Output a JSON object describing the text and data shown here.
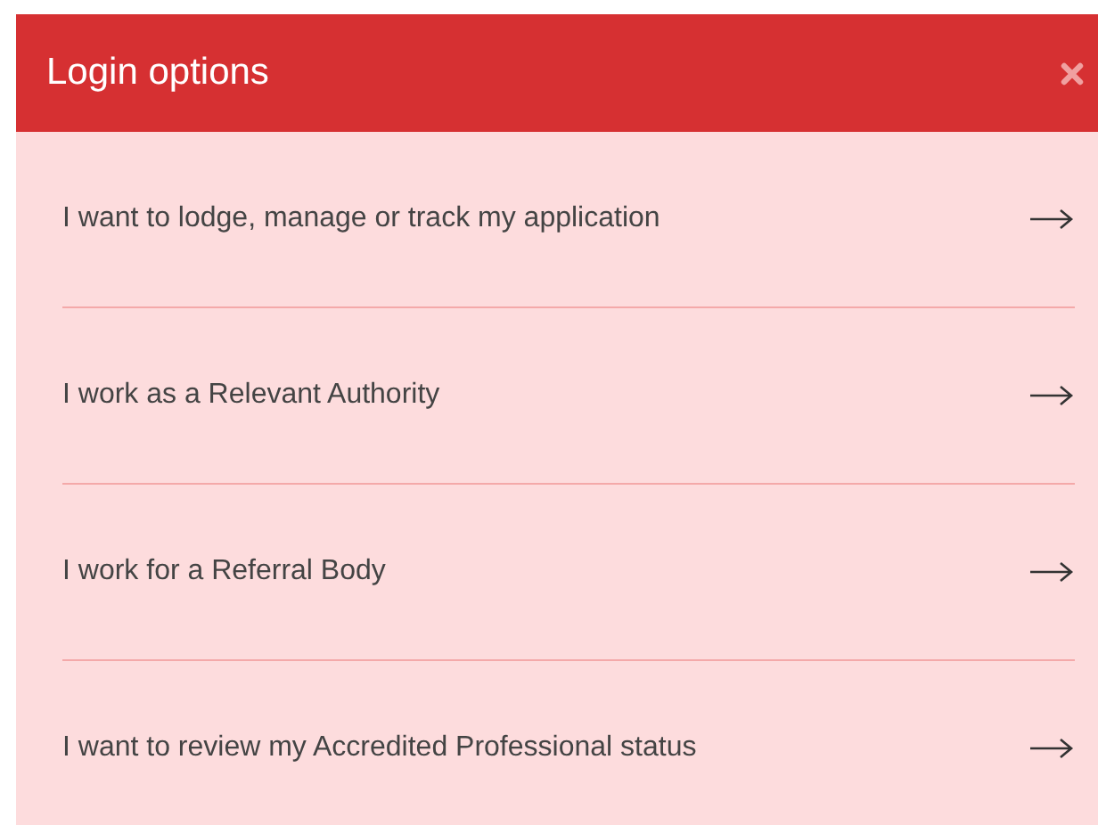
{
  "dialog": {
    "title": "Login options"
  },
  "options": [
    {
      "label": "I want to lodge, manage or track my application"
    },
    {
      "label": "I work as a Relevant Authority"
    },
    {
      "label": "I work for a Referral Body"
    },
    {
      "label": "I want to review my Accredited Professional status"
    }
  ]
}
